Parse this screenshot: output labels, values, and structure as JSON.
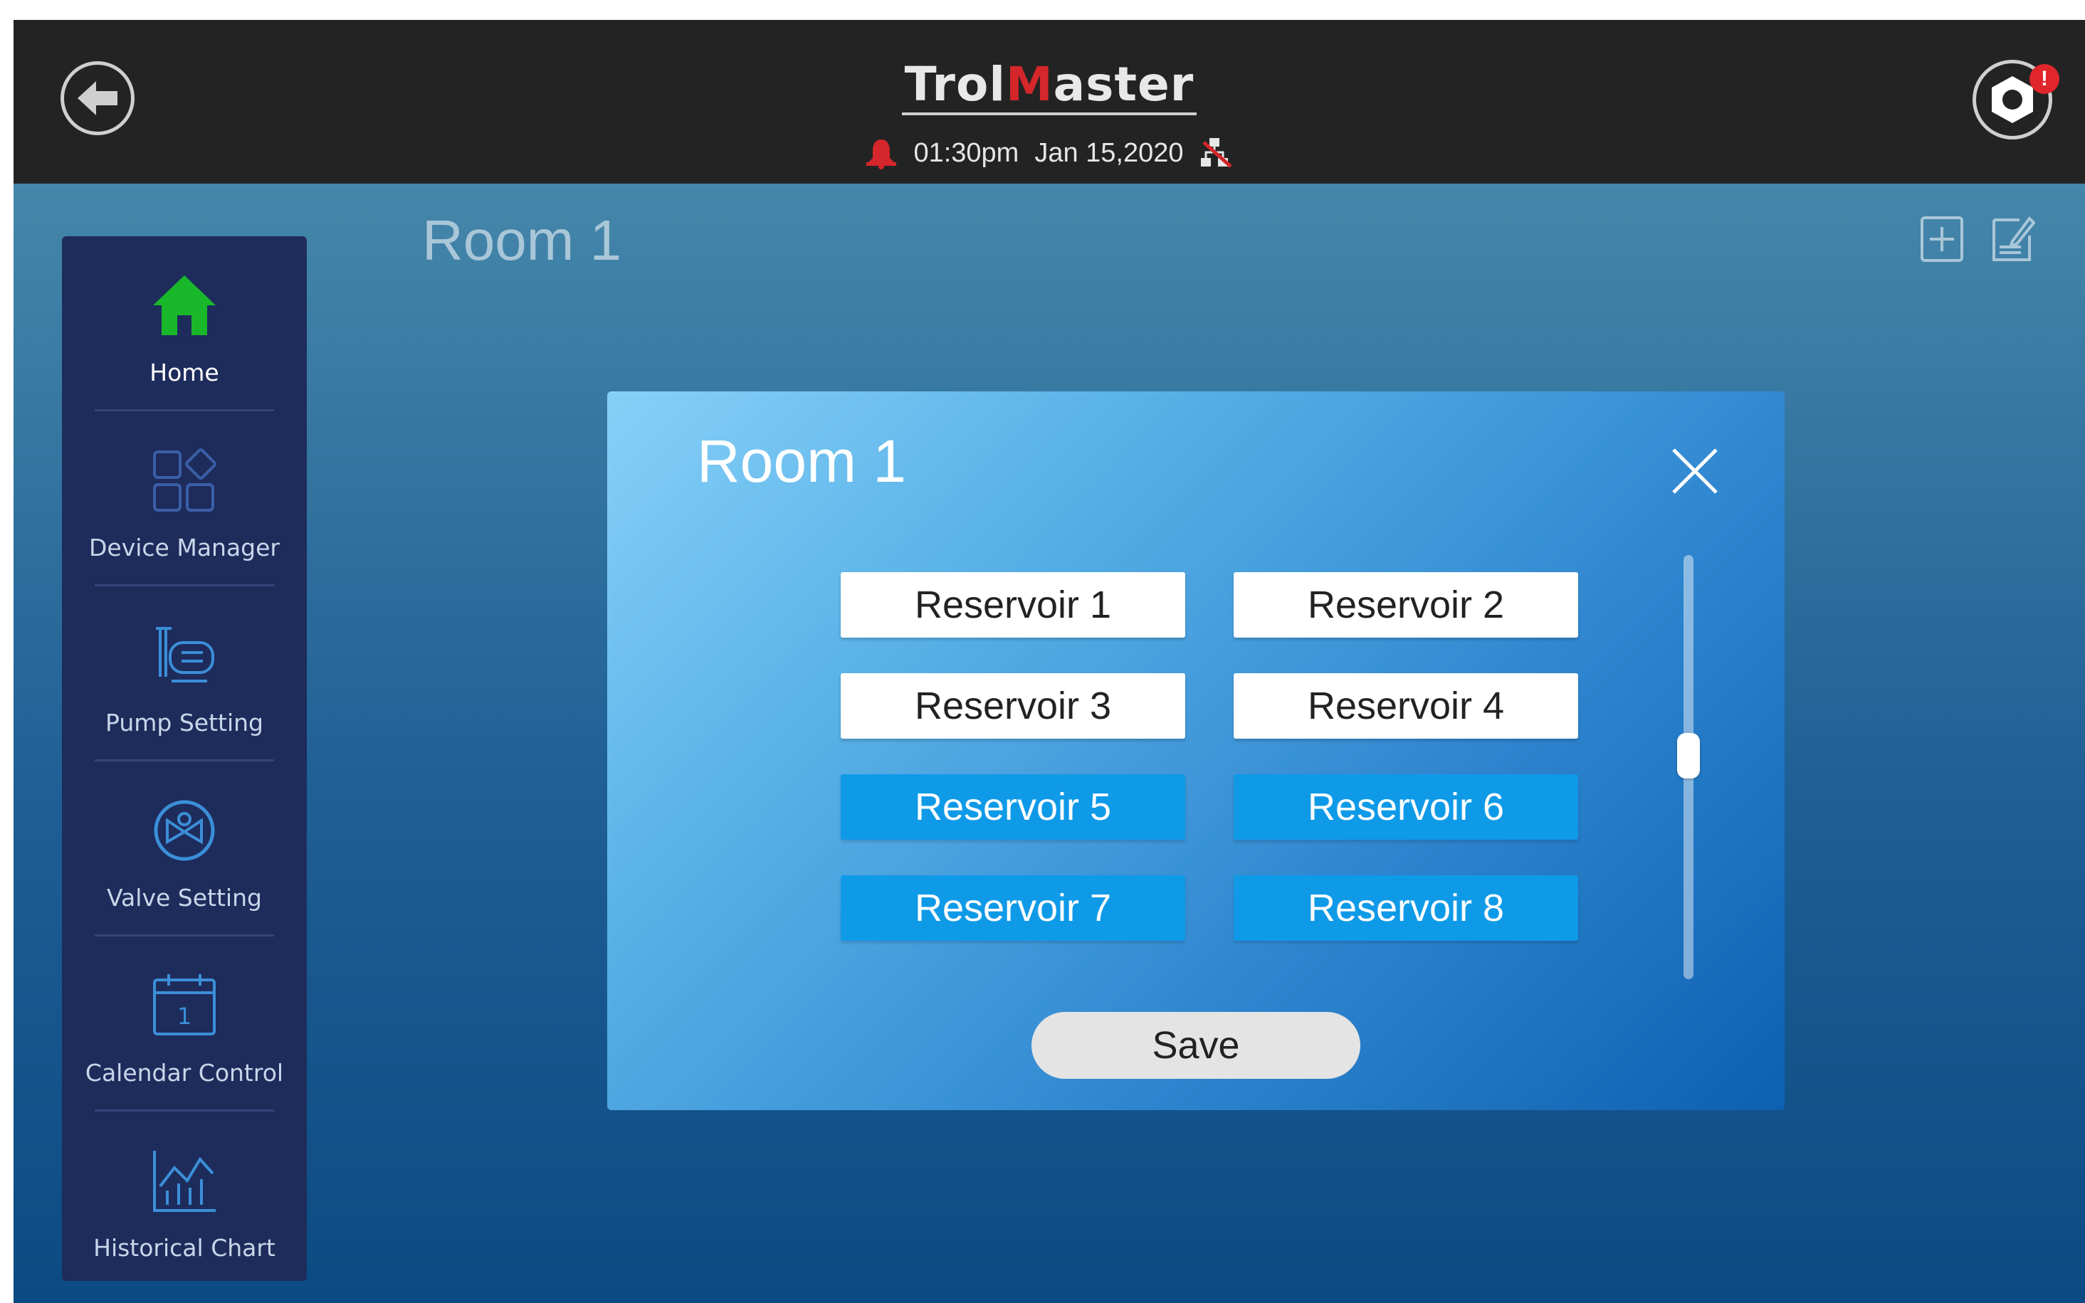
{
  "header": {
    "brand_prefix": "Trol",
    "brand_mid": "M",
    "brand_suffix": "aster",
    "time": "01:30pm",
    "date": "Jan 15,2020",
    "notification_badge": "!"
  },
  "page": {
    "title": "Room 1"
  },
  "sidebar": {
    "items": [
      {
        "label": "Home",
        "icon": "home-icon",
        "active": true
      },
      {
        "label": "Device Manager",
        "icon": "device-manager-icon"
      },
      {
        "label": "Pump Setting",
        "icon": "pump-icon"
      },
      {
        "label": "Valve Setting",
        "icon": "valve-icon"
      },
      {
        "label": "Calendar Control",
        "icon": "calendar-icon",
        "calendar_day": "1"
      },
      {
        "label": "Historical Chart",
        "icon": "chart-icon"
      }
    ]
  },
  "modal": {
    "title": "Room 1",
    "reservoirs": [
      {
        "label": "Reservoir 1",
        "selected": false
      },
      {
        "label": "Reservoir 2",
        "selected": false
      },
      {
        "label": "Reservoir 3",
        "selected": false
      },
      {
        "label": "Reservoir 4",
        "selected": false
      },
      {
        "label": "Reservoir 5",
        "selected": true
      },
      {
        "label": "Reservoir 6",
        "selected": true
      },
      {
        "label": "Reservoir 7",
        "selected": true
      },
      {
        "label": "Reservoir 8",
        "selected": true
      }
    ],
    "save_label": "Save",
    "scroll_position": 0.45
  },
  "colors": {
    "accent_selected": "#0f9ae8",
    "home_active": "#18b82a",
    "alert_red": "#d4262b"
  }
}
